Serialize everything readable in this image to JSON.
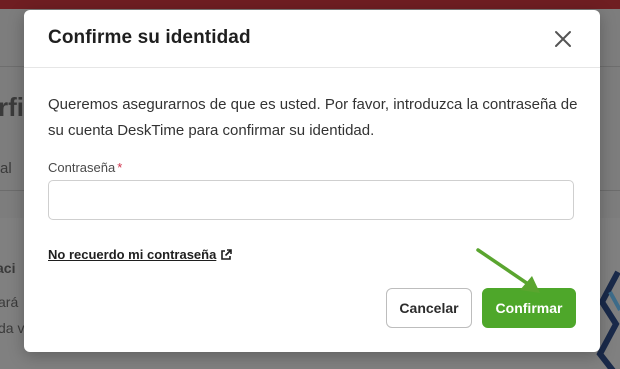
{
  "background": {
    "page_title_fragment": "rfi",
    "tab_fragment": "al",
    "card_title_fragment": "aci",
    "card_line1_fragment": "ará",
    "card_line2_fragment": "da v"
  },
  "modal": {
    "title": "Confirme su identidad",
    "close_icon": "close-icon",
    "description": "Queremos asegurarnos de que es usted. Por favor, introduzca la contraseña de su cuenta DeskTime para confirmar su identidad.",
    "password": {
      "label": "Contraseña",
      "required_marker": "*",
      "value": "",
      "placeholder": ""
    },
    "forgot_link": {
      "label": "No recuerdo mi contraseña",
      "icon": "external-link-icon"
    },
    "buttons": {
      "cancel_label": "Cancelar",
      "confirm_label": "Confirmar"
    },
    "annotation_arrow": "arrow-icon"
  },
  "colors": {
    "confirm_button": "#4ea72a",
    "annotation_arrow": "#5aa52f",
    "required_marker": "#d0314b",
    "topbar": "#6f1e22"
  }
}
